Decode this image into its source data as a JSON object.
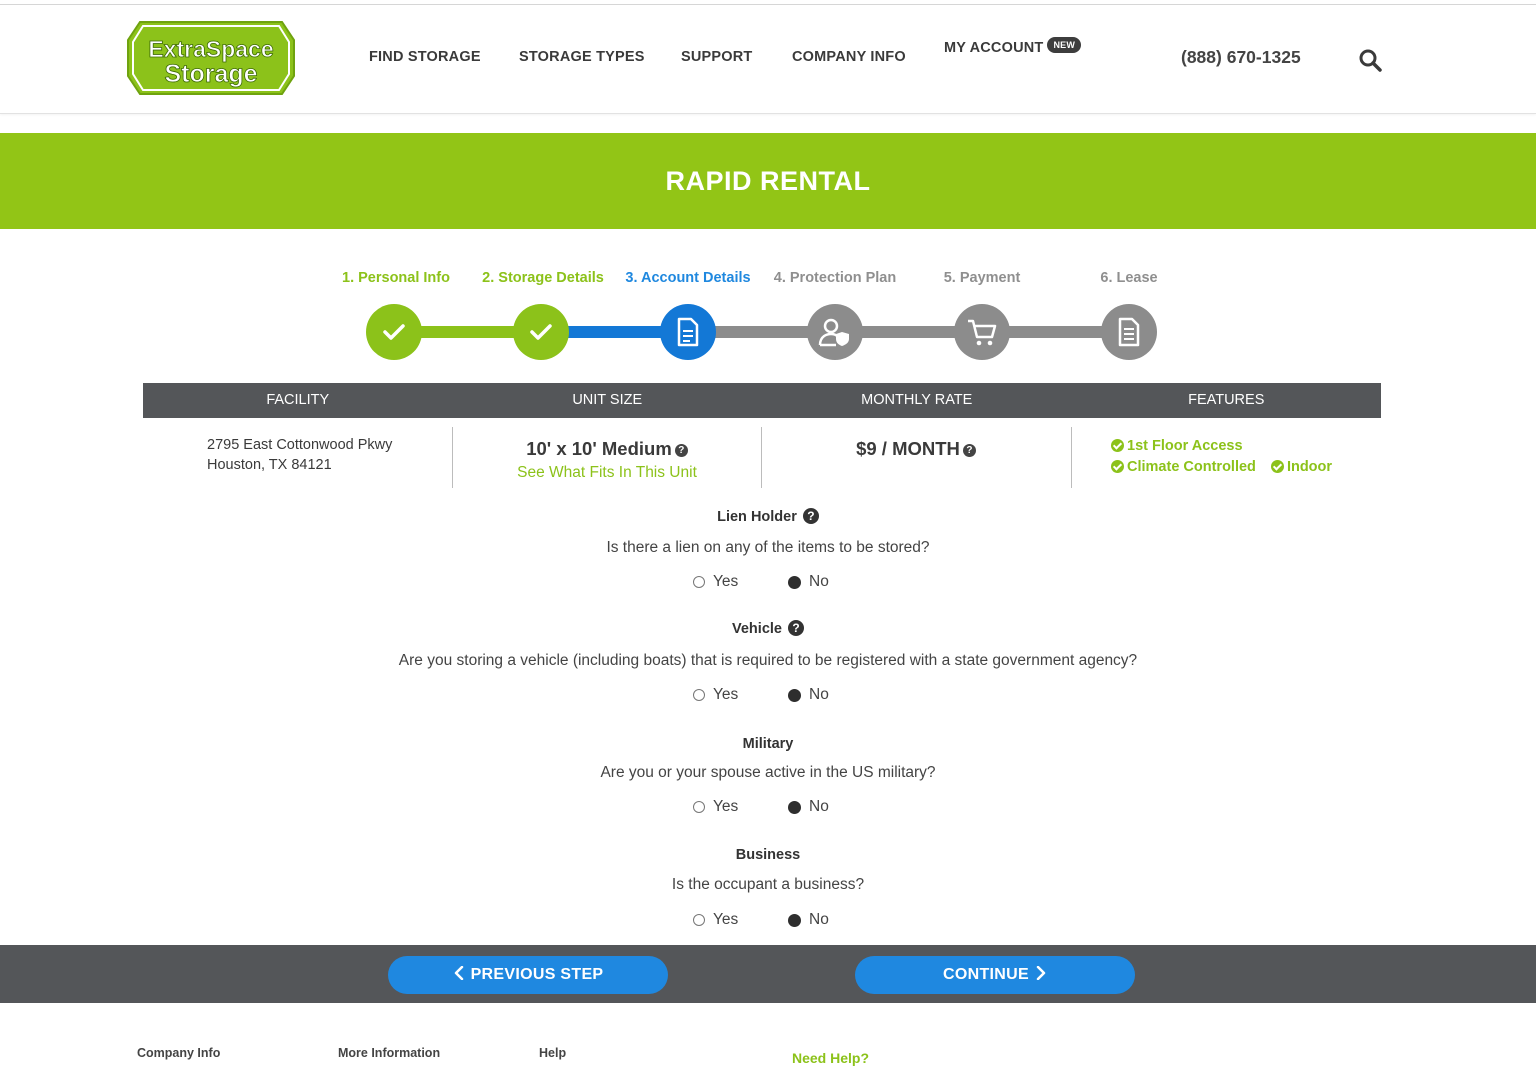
{
  "brand": {
    "line1": "ExtraSpace",
    "line2": "Storage",
    "reg": "®",
    "green": "#8cc21a",
    "blue": "#1f88e0"
  },
  "nav": {
    "items": [
      "FIND STORAGE",
      "STORAGE TYPES",
      "SUPPORT",
      "COMPANY INFO",
      "MY ACCOUNT"
    ],
    "badge": "NEW",
    "phone": "(888) 670-1325"
  },
  "banner": {
    "title": "RAPID RENTAL"
  },
  "steps": [
    {
      "label": "1. Personal Info",
      "state": "done",
      "icon": "check-icon"
    },
    {
      "label": "2. Storage Details",
      "state": "done",
      "icon": "check-icon"
    },
    {
      "label": "3. Account Details",
      "state": "current",
      "icon": "document-icon"
    },
    {
      "label": "4. Protection Plan",
      "state": "upcoming",
      "icon": "user-shield-icon"
    },
    {
      "label": "5. Payment",
      "state": "upcoming",
      "icon": "cart-icon"
    },
    {
      "label": "6. Lease",
      "state": "upcoming",
      "icon": "lease-document-icon"
    }
  ],
  "summary": {
    "headers": [
      "FACILITY",
      "UNIT SIZE",
      "MONTHLY RATE",
      "FEATURES"
    ],
    "address_line1": "2795 East Cottonwood Pkwy",
    "address_line2": "Houston, TX 84121",
    "unit_size": "10' x 10' Medium",
    "unit_link": "See What Fits In This Unit",
    "rate": "$9 / MONTH",
    "features": [
      "1st Floor Access",
      "Climate Controlled",
      "Indoor"
    ]
  },
  "questions": [
    {
      "title": "Lien Holder",
      "help": true,
      "text": "Is there a lien on any of the items to be stored?",
      "yes": "Yes",
      "no": "No",
      "selected": "No"
    },
    {
      "title": "Vehicle",
      "help": true,
      "text": "Are you storing a vehicle (including boats) that is required to be registered with a state government agency?",
      "yes": "Yes",
      "no": "No",
      "selected": "No"
    },
    {
      "title": "Military",
      "help": false,
      "text": "Are you or your spouse active in the US military?",
      "yes": "Yes",
      "no": "No",
      "selected": "No"
    },
    {
      "title": "Business",
      "help": false,
      "text": "Is the occupant a business?",
      "yes": "Yes",
      "no": "No",
      "selected": "No"
    }
  ],
  "buttons": {
    "previous": "PREVIOUS STEP",
    "continue": "CONTINUE"
  },
  "footer": {
    "col1": "Company Info",
    "col2": "More Information",
    "col3": "Help",
    "need_help": "Need Help?"
  }
}
